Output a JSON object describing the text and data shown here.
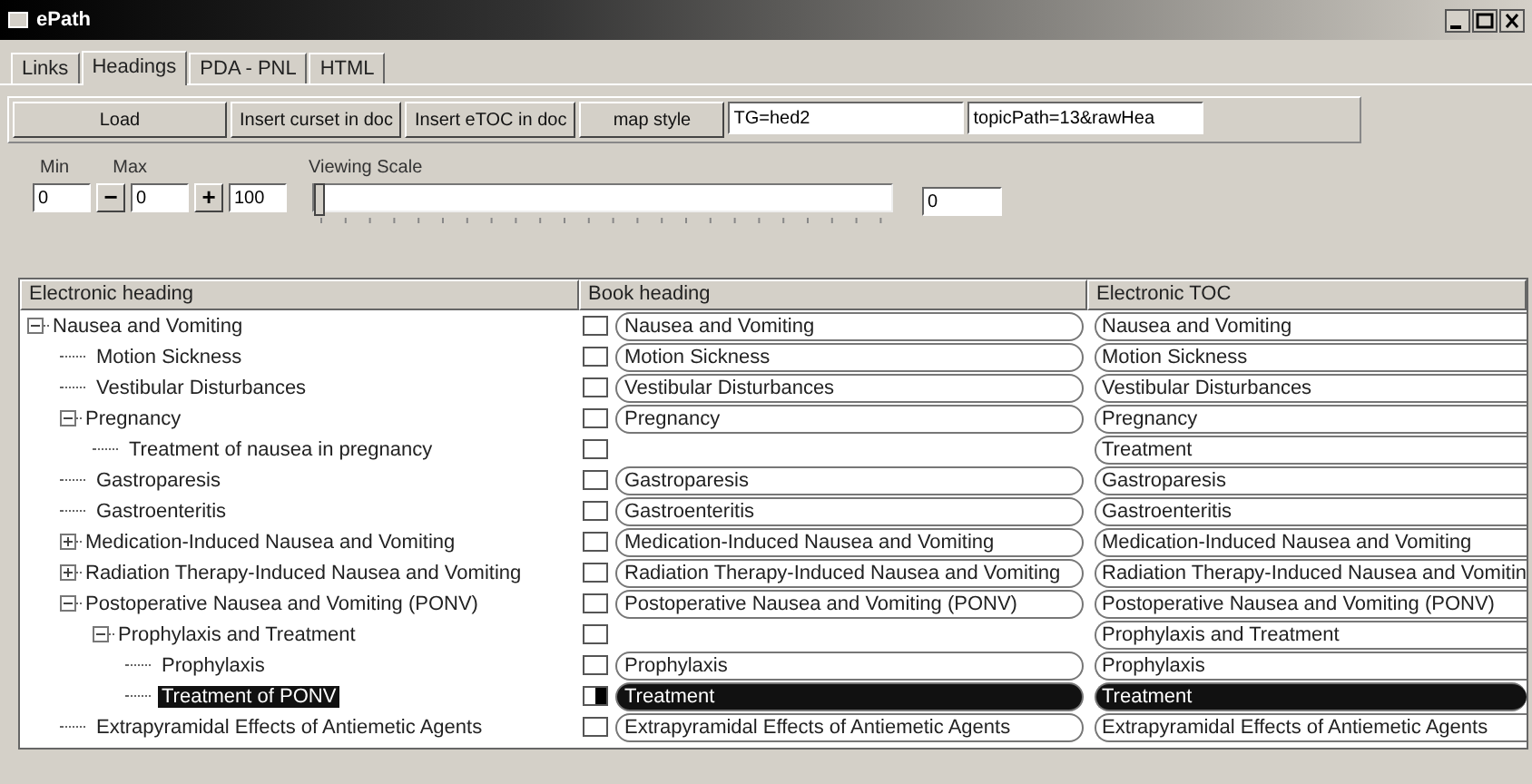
{
  "window": {
    "title": "ePath"
  },
  "tabs": [
    {
      "label": "Links",
      "selected": false
    },
    {
      "label": "Headings",
      "selected": true
    },
    {
      "label": "PDA - PNL",
      "selected": false
    },
    {
      "label": "HTML",
      "selected": false
    }
  ],
  "toolbar": {
    "buttons": [
      "Load",
      "Insert curset in doc",
      "Insert eTOC in doc",
      "map style"
    ],
    "fields": [
      {
        "value": "TG=hed2"
      },
      {
        "value": "topicPath=13&rawHea"
      }
    ]
  },
  "range": {
    "min_label": "Min",
    "min": "0",
    "max_label": "Max",
    "max": "0",
    "decrement": "−",
    "increment": "+",
    "step": "100"
  },
  "scale": {
    "label": "Viewing Scale",
    "level": 0,
    "reading": "0"
  },
  "columns": [
    "Electronic heading",
    "Book heading",
    "Electronic TOC"
  ],
  "tree": [
    {
      "text": "Nausea and Vomiting",
      "expanded": true,
      "selected": false,
      "checked": false,
      "book": "Nausea and Vomiting",
      "toc": "Nausea and Vomiting",
      "children": [
        {
          "text": "Motion Sickness",
          "selected": false,
          "checked": false,
          "book": "Motion Sickness",
          "toc": "Motion Sickness"
        },
        {
          "text": "Vestibular Disturbances",
          "selected": false,
          "checked": false,
          "book": "Vestibular Disturbances",
          "toc": "Vestibular Disturbances"
        },
        {
          "text": "Pregnancy",
          "expanded": true,
          "selected": false,
          "checked": false,
          "book": "Pregnancy",
          "toc": "Pregnancy",
          "children": [
            {
              "text": "Treatment of nausea in pregnancy",
              "selected": false,
              "checked": false,
              "toc": "Treatment"
            }
          ]
        },
        {
          "text": "Gastroparesis",
          "selected": false,
          "checked": false,
          "book": "Gastroparesis",
          "toc": "Gastroparesis"
        },
        {
          "text": "Gastroenteritis",
          "selected": false,
          "checked": false,
          "book": "Gastroenteritis",
          "toc": "Gastroenteritis"
        },
        {
          "text": "Medication-Induced Nausea and Vomiting",
          "expanded": false,
          "selected": false,
          "checked": false,
          "book": "Medication-Induced Nausea and Vomiting",
          "toc": "Medication-Induced Nausea and Vomiting"
        },
        {
          "text": "Radiation Therapy-Induced Nausea and Vomiting",
          "expanded": false,
          "selected": false,
          "checked": false,
          "book": "Radiation Therapy-Induced Nausea and Vomiting",
          "toc": "Radiation Therapy-Induced Nausea and Vomitin"
        },
        {
          "text": "Postoperative Nausea and Vomiting (PONV)",
          "expanded": true,
          "selected": false,
          "checked": false,
          "book": "Postoperative Nausea and Vomiting (PONV)",
          "toc": "Postoperative Nausea and Vomiting (PONV)",
          "children": [
            {
              "text": "Prophylaxis and Treatment",
              "expanded": true,
              "selected": false,
              "checked": false,
              "toc": "Prophylaxis and Treatment",
              "children": [
                {
                  "text": "Prophylaxis",
                  "selected": false,
                  "checked": false,
                  "book": "Prophylaxis",
                  "toc": "Prophylaxis"
                },
                {
                  "text": "Treatment of PONV",
                  "selected": true,
                  "checked": true,
                  "book": "Treatment",
                  "toc": "Treatment"
                }
              ]
            }
          ]
        },
        {
          "text": "Extrapyramidal Effects of Antiemetic Agents",
          "selected": false,
          "checked": false,
          "book": "Extrapyramidal Effects of Antiemetic Agents",
          "toc": "Extrapyramidal Effects of Antiemetic Agents"
        }
      ]
    }
  ]
}
